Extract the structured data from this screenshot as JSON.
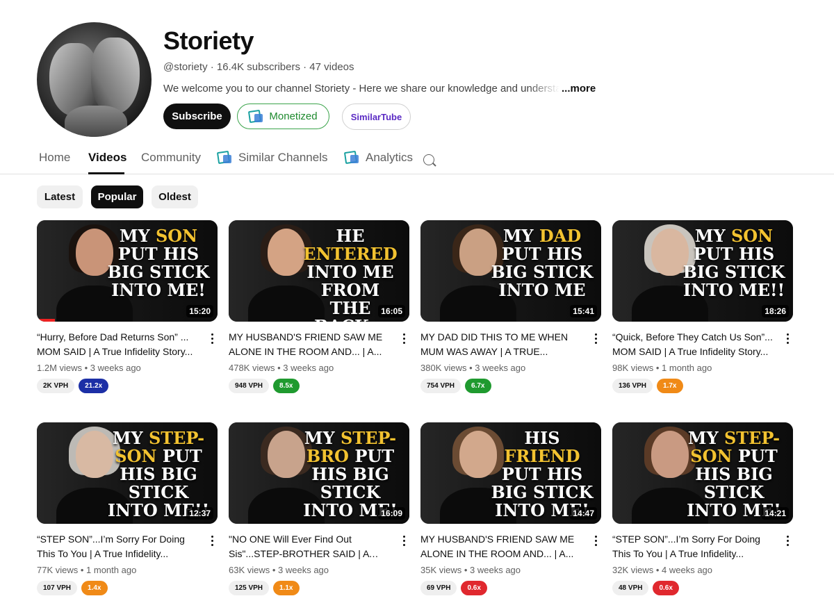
{
  "channel": {
    "name": "Storiety",
    "meta": "@storiety · 16.4K subscribers · 47 videos",
    "description": "We welcome you to our channel Storiety -  Here we share our knowledge and understanding",
    "more_label": "...more",
    "subscribe_label": "Subscribe",
    "monetized_label": "Monetized",
    "similartube_label": "SimilarTube"
  },
  "tabs": [
    {
      "label": "Home"
    },
    {
      "label": "Videos"
    },
    {
      "label": "Community"
    },
    {
      "label": "Similar Channels"
    },
    {
      "label": "Analytics"
    }
  ],
  "active_tab": "Videos",
  "filters": [
    {
      "label": "Latest"
    },
    {
      "label": "Popular"
    },
    {
      "label": "Oldest"
    }
  ],
  "selected_filter": "Popular",
  "videos": [
    {
      "thumb_line1": "MY ",
      "thumb_hl": "SON",
      "thumb_rest": "PUT HIS BIG STICK INTO ME!",
      "duration": "15:20",
      "title": "“Hurry, Before Dad Returns Son” ... MOM SAID | A True Infidelity Story...",
      "meta": "1.2M views • 3 weeks ago",
      "vph": "2K VPH",
      "mult": "21.2x",
      "mult_color": "#1c2fa6"
    },
    {
      "thumb_line1": "HE ",
      "thumb_hl": "ENTERED",
      "thumb_rest": "INTO ME FROM THE BACK...",
      "duration": "16:05",
      "title": "MY HUSBAND'S FRIEND SAW ME ALONE IN THE ROOM AND... | A...",
      "meta": "478K views • 3 weeks ago",
      "vph": "948 VPH",
      "mult": "8.5x",
      "mult_color": "#1f9a2f"
    },
    {
      "thumb_line1": "MY ",
      "thumb_hl": "DAD",
      "thumb_rest": "PUT HIS BIG STICK INTO ME",
      "duration": "15:41",
      "title": "MY DAD DID THIS TO ME WHEN MUM WAS AWAY | A TRUE...",
      "meta": "380K views • 3 weeks ago",
      "vph": "754 VPH",
      "mult": "6.7x",
      "mult_color": "#1f9a2f"
    },
    {
      "thumb_line1": "MY ",
      "thumb_hl": "SON",
      "thumb_rest": "PUT HIS BIG STICK INTO ME!!",
      "duration": "18:26",
      "title": "“Quick, Before They Catch Us Son”... MOM SAID | A True Infidelity Story...",
      "meta": "98K views • 1 month ago",
      "vph": "136 VPH",
      "mult": "1.7x",
      "mult_color": "#f08a17"
    },
    {
      "thumb_line1": "MY ",
      "thumb_hl": "STEP-SON",
      "thumb_rest": "PUT HIS BIG STICK INTO ME!!",
      "duration": "12:37",
      "title": "“STEP SON”...I’m Sorry For Doing This To You | A True Infidelity...",
      "meta": "77K views • 1 month ago",
      "vph": "107 VPH",
      "mult": "1.4x",
      "mult_color": "#f08a17"
    },
    {
      "thumb_line1": "MY ",
      "thumb_hl": "STEP-BRO",
      "thumb_rest": "PUT HIS BIG STICK INTO ME!",
      "duration": "16:09",
      "title": "\"NO ONE Will Ever Find Out Sis\"...STEP-BROTHER SAID | A Tru...",
      "meta": "63K views • 3 weeks ago",
      "vph": "125 VPH",
      "mult": "1.1x",
      "mult_color": "#f08a17"
    },
    {
      "thumb_line1": "HIS ",
      "thumb_hl": "FRIEND",
      "thumb_rest": "PUT HIS BIG STICK INTO ME!",
      "duration": "14:47",
      "title": "MY HUSBAND'S FRIEND SAW ME ALONE IN THE ROOM AND... | A...",
      "meta": "35K views • 3 weeks ago",
      "vph": "69 VPH",
      "mult": "0.6x",
      "mult_color": "#e0282e"
    },
    {
      "thumb_line1": "MY ",
      "thumb_hl": "STEP-SON",
      "thumb_rest": "PUT HIS BIG STICK INTO ME!",
      "duration": "14:21",
      "title": "“STEP SON”...I’m Sorry For Doing This To You | A True Infidelity...",
      "meta": "32K views • 4 weeks ago",
      "vph": "48 VPH",
      "mult": "0.6x",
      "mult_color": "#e0282e"
    }
  ],
  "icons": {
    "search": "search-icon",
    "nexlev": "nexlev-logo-icon",
    "more": "vertical-dots-icon"
  }
}
